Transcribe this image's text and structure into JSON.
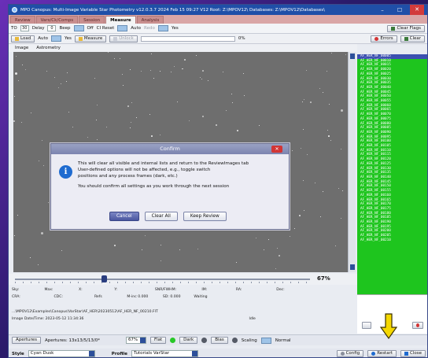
{
  "window": {
    "title": "MPO Canopus: Multi-Image Variable Star Photometry  v12.0.3.7  2024 Feb 15  09:27    V12 Root: Z:\\MPOV12\\  Databases: Z:\\MPOV12\\Databases\\",
    "minimize": "–",
    "maximize": "☐",
    "close": "✕"
  },
  "tabs": [
    {
      "label": "Review"
    },
    {
      "label": "Vars/Ck/Comps"
    },
    {
      "label": "Session"
    },
    {
      "label": "Measure"
    },
    {
      "label": "Analysis"
    }
  ],
  "toolbar1": {
    "to_label": "TO",
    "to_value": "30",
    "delay_label": "Delay",
    "delay_value": "0",
    "beep_label": "Beep",
    "beep_state": "Off",
    "ci_reset_label": "CI Reset",
    "ci_reset_state": "Auto",
    "redo_label": "Redo",
    "redo_state": "Yes",
    "clear_flags": "Clear Flags"
  },
  "toolbar2": {
    "load": "Load",
    "auto_label": "Auto",
    "auto_state": "Yes",
    "measure": "Measure",
    "unlock": "Unlock",
    "progress": "0%",
    "errors": "Errors",
    "clear": "Clear"
  },
  "image_tabs": [
    {
      "label": "Image"
    },
    {
      "label": "Astrometry"
    }
  ],
  "file_list": [
    "AF_HER_NF_00005",
    "AF_HER_NF_00010",
    "AF_HER_NF_00015",
    "AF_HER_NF_00020",
    "AF_HER_NF_00025",
    "AF_HER_NF_00030",
    "AF_HER_NF_00035",
    "AF_HER_NF_00040",
    "AF_HER_NF_00045",
    "AF_HER_NF_00050",
    "AF_HER_NF_00055",
    "AF_HER_NF_00060",
    "AF_HER_NF_00065",
    "AF_HER_NF_00070",
    "AF_HER_NF_00075",
    "AF_HER_NF_00080",
    "AF_HER_NF_00085",
    "AF_HER_NF_00090",
    "AF_HER_NF_00095",
    "AF_HER_NF_00100",
    "AF_HER_NF_00105",
    "AF_HER_NF_00110",
    "AF_HER_NF_00115",
    "AF_HER_NF_00120",
    "AF_HER_NF_00125",
    "AF_HER_NF_00130",
    "AF_HER_NF_00135",
    "AF_HER_NF_00140",
    "AF_HER_NF_00145",
    "AF_HER_NF_00150",
    "AF_HER_NF_00155",
    "AF_HER_NF_00160",
    "AF_HER_NF_00165",
    "AF_HER_NF_00170",
    "AF_HER_NF_00175",
    "AF_HER_NF_00180",
    "AF_HER_NF_00185",
    "AF_HER_NF_00190",
    "AF_HER_NF_00195",
    "AF_HER_NF_00200",
    "AF_HER_NF_00205",
    "AF_HER_NF_00210"
  ],
  "zoom": {
    "label": "67%",
    "value": 67
  },
  "info": {
    "sky": "Sky:",
    "max": "Max:",
    "x": "X:",
    "y": "Y:",
    "snr": "SNR/FWHM:",
    "im": "IM:",
    "ra": "RA:",
    "dec": "Dec:",
    "cra": "CRA:",
    "cdc": "CDC:",
    "refs": "Refs",
    "m_inc": "M-inc 0.000",
    "sd": "SD: 0.000",
    "waiting": "Waiting",
    "path": "...\\MPOV12\\Examples\\Canopus\\VarStar\\AF_HER\\20230512\\AF_HER_NF_00210.FIT",
    "datetime": "Image Date/Time: 2023-05-12  11:34:36",
    "idle": "Idle"
  },
  "bottom": {
    "apertures_btn": "Apertures",
    "apertures_value": "Apertures: 13x13/5/13/0*",
    "zoom_value": "67%",
    "flat": "Flat",
    "dark": "Dark",
    "bias": "Bias",
    "scaling_label": "Scaling",
    "scaling_value": "Normal"
  },
  "status": {
    "style_label": "Style",
    "style_value": "Cyan Dusk",
    "profile_label": "Profile",
    "profile_value": "Tutorials VarStar",
    "config": "Config",
    "restart": "Restart",
    "close": "Close"
  },
  "dialog": {
    "title": "Confirm",
    "line1": "This will clear all visible and internal lists and return to the ReviewImages tab",
    "line2": "User-defined options will not be affected, e.g., toggle switch",
    "line3": "positions and any process frames (dark, etc.)",
    "line4": "You should confirm all settings as you work through the next session",
    "cancel": "Cancel",
    "clear_all": "Clear All",
    "keep_review": "Keep Review"
  },
  "colors": {
    "accent": "#1f4fa8",
    "list_bg": "#1ec51e",
    "highlight_arrow": "#f5d800"
  }
}
